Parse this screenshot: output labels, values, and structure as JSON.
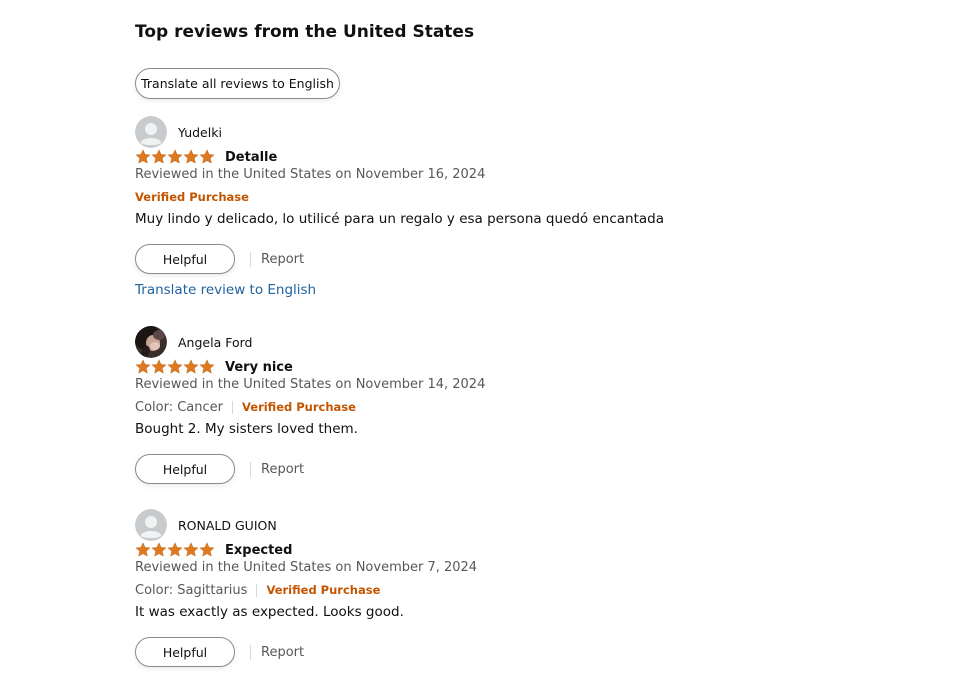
{
  "header": {
    "title": "Top reviews from the United States",
    "translate_all_label": "Translate all reviews to English"
  },
  "colors": {
    "star": "#de7921",
    "verified": "#c45500",
    "link": "#2162a1",
    "secondary_text": "#565959"
  },
  "reviews": [
    {
      "reviewer": "Yudelki",
      "avatar": "default-avatar-icon",
      "rating": 5,
      "title": "Detalle",
      "date": "Reviewed in the United States on November 16, 2024",
      "color_variant": "",
      "verified": "Verified Purchase",
      "body": "Muy lindo y delicado, lo utilicé para un regalo y esa persona quedó encantada",
      "helpful_label": "Helpful",
      "report_label": "Report",
      "translate_label": "Translate review to English"
    },
    {
      "reviewer": "Angela Ford",
      "avatar": "profile-photo",
      "rating": 5,
      "title": "Very nice",
      "date": "Reviewed in the United States on November 14, 2024",
      "color_variant": "Color: Cancer",
      "verified": "Verified Purchase",
      "body": "Bought 2. My sisters loved them.",
      "helpful_label": "Helpful",
      "report_label": "Report"
    },
    {
      "reviewer": "RONALD GUION",
      "avatar": "default-avatar-icon",
      "rating": 5,
      "title": "Expected",
      "date": "Reviewed in the United States on November 7, 2024",
      "color_variant": "Color: Sagittarius",
      "verified": "Verified Purchase",
      "body": "It was exactly as expected. Looks good.",
      "helpful_label": "Helpful",
      "report_label": "Report"
    }
  ]
}
